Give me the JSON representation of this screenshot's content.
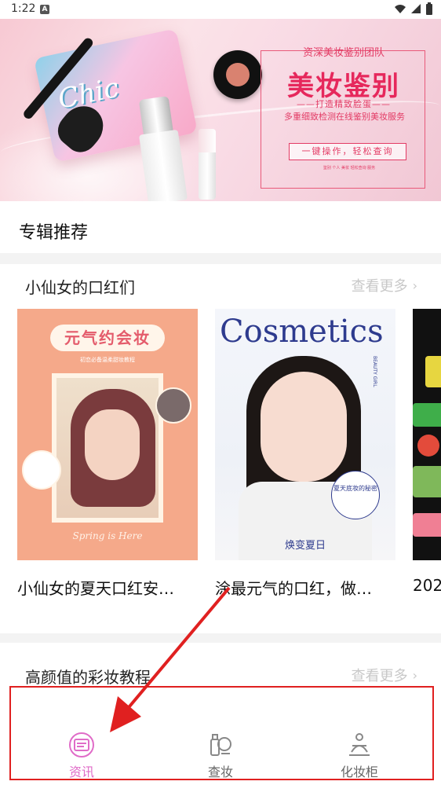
{
  "status_bar": {
    "time": "1:22",
    "indicator": "A",
    "icons": [
      "wifi-icon",
      "signal-icon",
      "battery-icon"
    ]
  },
  "banner": {
    "team": "资深美妆鉴别团队",
    "title": "美妆鉴别",
    "slogan": "——打造精致脸蛋——",
    "service": "多重细致检测在线鉴别美妆服务",
    "button": "一键操作，轻松查询",
    "small_print": "鉴别 个人 美妆 轻松查询 服务",
    "palette_text": "Chic",
    "accent": "#e6285c"
  },
  "section": {
    "title": "专辑推荐"
  },
  "albums": [
    {
      "title": "小仙女的口红们",
      "more": "查看更多",
      "cards": [
        {
          "title": "小仙女的夏天口红安…",
          "cover_heading": "元气约会妆",
          "cover_subtitle": "初恋必备温柔甜妆教程",
          "cover_footer": "Spring is Here"
        },
        {
          "title": "涂最元气的口红，做…",
          "cover_heading": "Cosmetics",
          "cover_badge": "夏天底妆的秘密",
          "cover_bottom": "焕变夏日",
          "cover_side": "BEAUTY GIRL"
        },
        {
          "title": "202"
        }
      ]
    },
    {
      "title": "高颜值的彩妆教程",
      "more": "查看更多"
    }
  ],
  "bottom_nav": {
    "items": [
      {
        "label": "资讯",
        "icon": "news-icon",
        "active": true
      },
      {
        "label": "查妆",
        "icon": "cosmetics-check-icon",
        "active": false
      },
      {
        "label": "化妆柜",
        "icon": "makeup-cabinet-icon",
        "active": false
      }
    ],
    "active_color": "#e06cc8",
    "inactive_color": "#666666"
  },
  "annotation": {
    "color": "#e02020"
  }
}
